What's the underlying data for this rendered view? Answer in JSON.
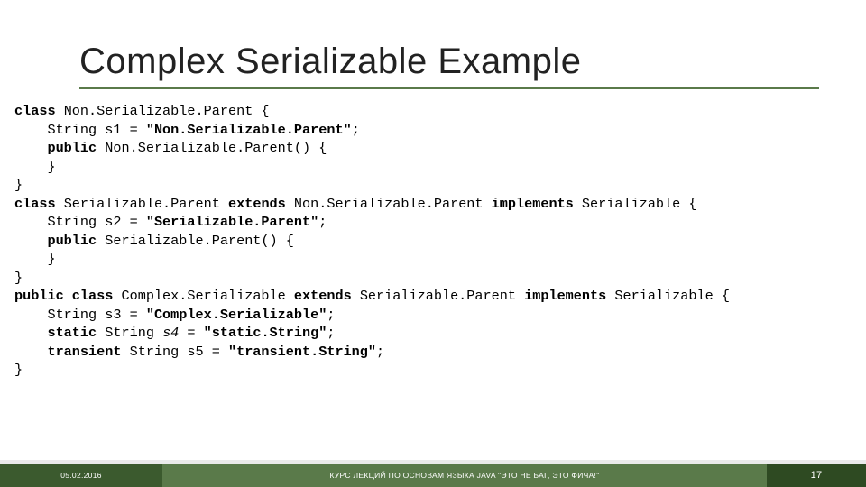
{
  "title": "Complex Serializable Example",
  "code": {
    "l1a": "class",
    "l1b": " Non.Serializable.Parent {",
    "l2a": "    String s1 = ",
    "l2b": "\"Non.Serializable.Parent\"",
    "l2c": ";",
    "l3a": "    public",
    "l3b": " Non.Serializable.Parent() {",
    "l4": "    }",
    "l5": "}",
    "l6a": "class",
    "l6b": " Serializable.Parent ",
    "l6c": "extends",
    "l6d": " Non.Serializable.Parent ",
    "l6e": "implements",
    "l6f": " Serializable {",
    "l7a": "    String s2 = ",
    "l7b": "\"Serializable.Parent\"",
    "l7c": ";",
    "l8a": "    public",
    "l8b": " Serializable.Parent() {",
    "l9": "    }",
    "l10": "}",
    "l11a": "public class",
    "l11b": " Complex.Serializable ",
    "l11c": "extends",
    "l11d": " Serializable.Parent ",
    "l11e": "implements",
    "l11f": " Serializable {",
    "l12a": "    String s3 = ",
    "l12b": "\"Complex.Serializable\"",
    "l12c": ";",
    "l13a": "    static",
    "l13b": " String ",
    "l13c": "s4",
    "l13d": " = ",
    "l13e": "\"static.String\"",
    "l13f": ";",
    "l14a": "    transient",
    "l14b": " String s5 = ",
    "l14c": "\"transient.String\"",
    "l14d": ";",
    "l15": "}"
  },
  "footer": {
    "date": "05.02.2016",
    "mid": "КУРС ЛЕКЦИЙ ПО ОСНОВАМ ЯЗЫКА JAVA \"ЭТО НЕ БАГ, ЭТО ФИЧА!\"",
    "page": "17"
  }
}
